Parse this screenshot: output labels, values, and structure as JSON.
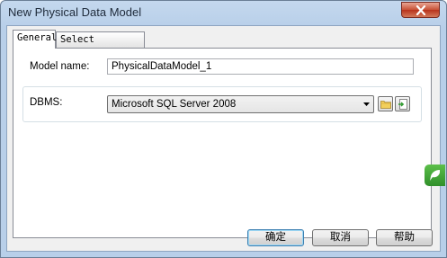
{
  "window": {
    "title": "New Physical Data Model"
  },
  "tabs": [
    {
      "label": "General"
    },
    {
      "label": "Select Extensions"
    }
  ],
  "form": {
    "model_name_label": "Model name:",
    "model_name_value": "PhysicalDataModel_1",
    "dbms_label": "DBMS:",
    "dbms_value": "Microsoft SQL Server 2008"
  },
  "buttons": {
    "ok": "确定",
    "cancel": "取消",
    "help": "帮助"
  },
  "icons": {
    "close": "close-icon",
    "browse": "folder-icon",
    "import": "import-icon",
    "side": "side-app-icon"
  }
}
